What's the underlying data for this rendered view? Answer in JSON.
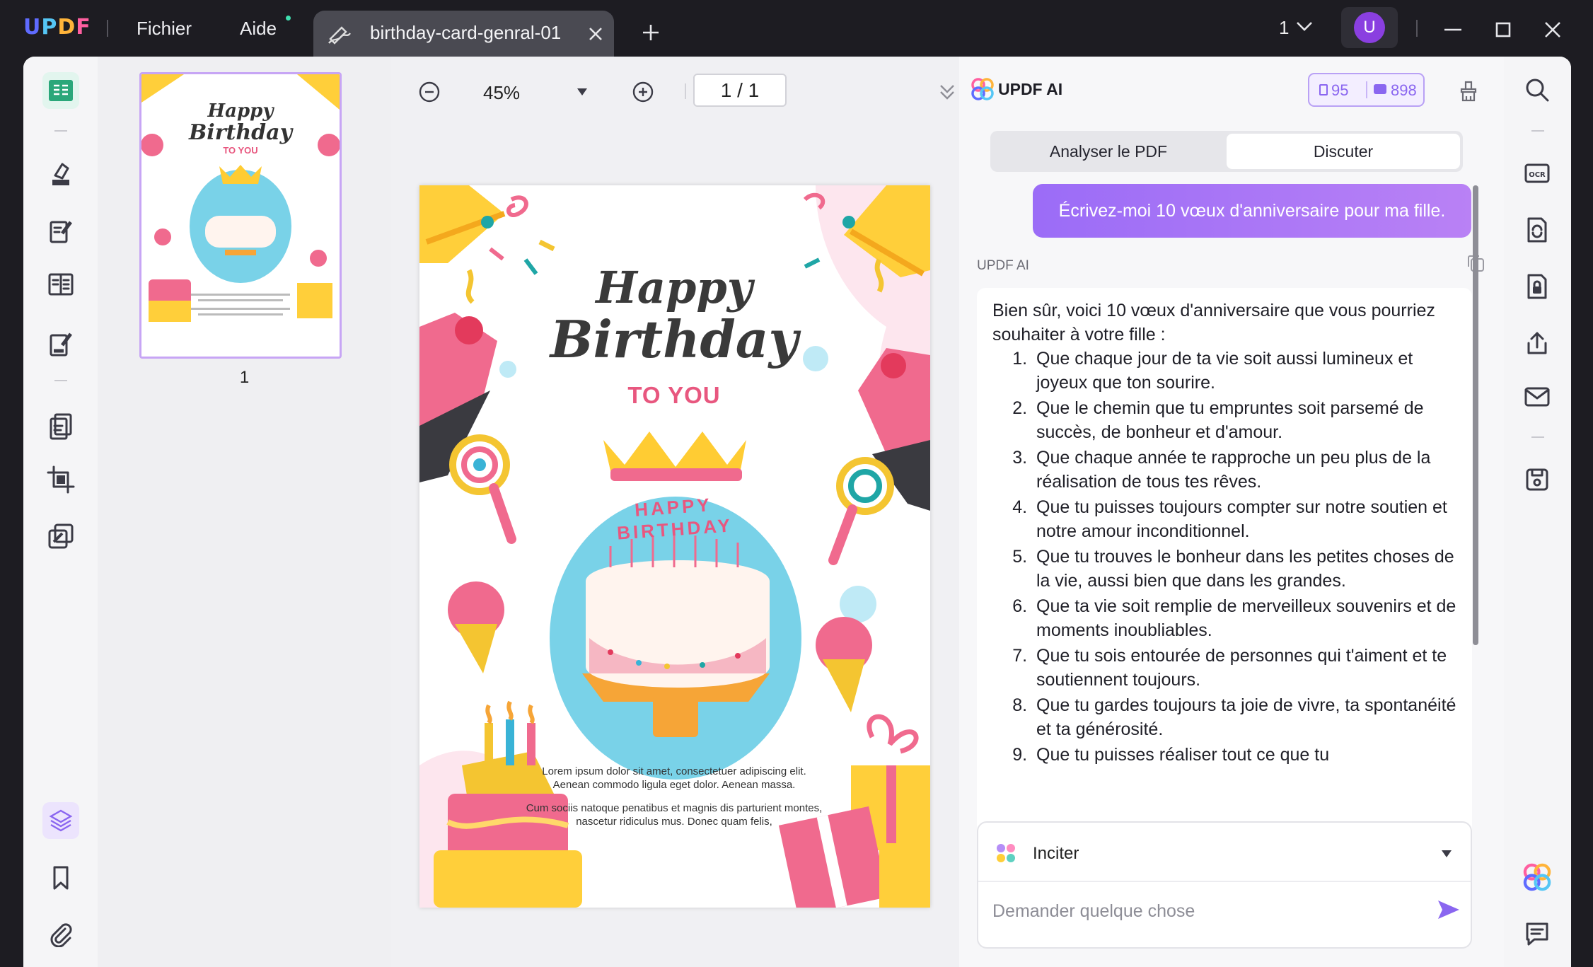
{
  "app": {
    "logo": "UPDF"
  },
  "menu": {
    "file": "Fichier",
    "help": "Aide"
  },
  "tab": {
    "title": "birthday-card-genral-01"
  },
  "titlebar": {
    "page_count": "1",
    "avatar_letter": "U"
  },
  "thumbnails": {
    "page_label": "1"
  },
  "viewer": {
    "zoom": "45%",
    "current_page": "1",
    "total_pages": "1",
    "page_separator": "/"
  },
  "card": {
    "happy": "Happy",
    "birthday": "Birthday",
    "to_you": "TO YOU",
    "cake_letters": "HAPPY BIRTHDAY",
    "lorem1": "Lorem ipsum dolor sit amet, consectetuer adipiscing elit. Aenean commodo ligula eget dolor. Aenean massa.",
    "lorem2": "Cum sociis natoque penatibus et magnis dis parturient montes, nascetur ridiculus mus. Donec quam felis,"
  },
  "ai": {
    "title": "UPDF AI",
    "quota_docs": "95",
    "quota_chats": "898",
    "tab_analyze": "Analyser le PDF",
    "tab_chat": "Discuter",
    "user_message": "Écrivez-moi 10 vœux d'anniversaire pour ma fille.",
    "reply_label": "UPDF AI",
    "reply_intro": "Bien sûr, voici 10 vœux d'anniversaire que vous pourriez souhaiter à votre fille :",
    "wishes": [
      "Que chaque jour de ta vie soit aussi lumineux et joyeux que ton sourire.",
      "Que le chemin que tu empruntes soit parsemé de succès, de bonheur et d'amour.",
      "Que chaque année te rapproche un peu plus de la réalisation de tous tes rêves.",
      "Que tu puisses toujours compter sur notre soutien et notre amour inconditionnel.",
      "Que tu trouves le bonheur dans les petites choses de la vie, aussi bien que dans les grandes.",
      "Que ta vie soit remplie de merveilleux souvenirs et de moments inoubliables.",
      "Que tu sois entourée de personnes qui t'aiment et te soutiennent toujours.",
      "Que tu gardes toujours ta joie de vivre, ta spontanéité et ta générosité.",
      "Que tu puisses réaliser tout ce que tu"
    ],
    "prompt_label": "Inciter",
    "input_placeholder": "Demander quelque chose"
  },
  "colors": {
    "accent": "#8a66f0",
    "bubble": "#a571f6",
    "title_pink": "#e8577f",
    "bg_dark": "#1d1c22"
  }
}
